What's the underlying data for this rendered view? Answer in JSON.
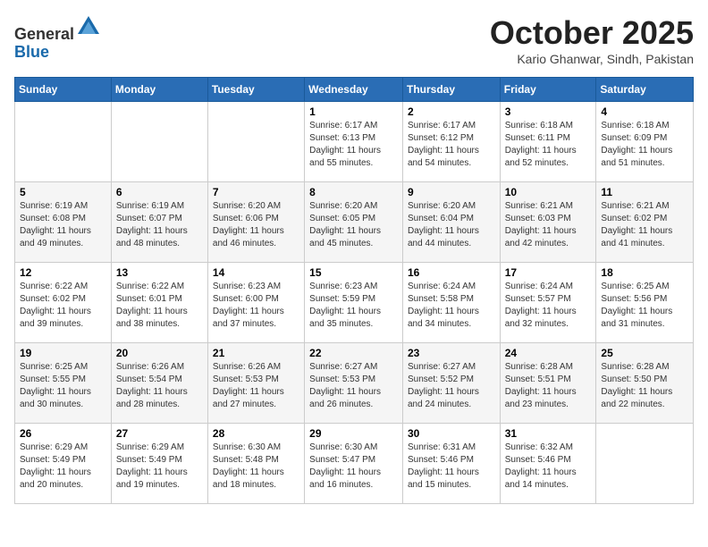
{
  "header": {
    "logo_line1": "General",
    "logo_line2": "Blue",
    "month_title": "October 2025",
    "location": "Kario Ghanwar, Sindh, Pakistan"
  },
  "days_of_week": [
    "Sunday",
    "Monday",
    "Tuesday",
    "Wednesday",
    "Thursday",
    "Friday",
    "Saturday"
  ],
  "weeks": [
    [
      {
        "day": "",
        "info": ""
      },
      {
        "day": "",
        "info": ""
      },
      {
        "day": "",
        "info": ""
      },
      {
        "day": "1",
        "info": "Sunrise: 6:17 AM\nSunset: 6:13 PM\nDaylight: 11 hours\nand 55 minutes."
      },
      {
        "day": "2",
        "info": "Sunrise: 6:17 AM\nSunset: 6:12 PM\nDaylight: 11 hours\nand 54 minutes."
      },
      {
        "day": "3",
        "info": "Sunrise: 6:18 AM\nSunset: 6:11 PM\nDaylight: 11 hours\nand 52 minutes."
      },
      {
        "day": "4",
        "info": "Sunrise: 6:18 AM\nSunset: 6:09 PM\nDaylight: 11 hours\nand 51 minutes."
      }
    ],
    [
      {
        "day": "5",
        "info": "Sunrise: 6:19 AM\nSunset: 6:08 PM\nDaylight: 11 hours\nand 49 minutes."
      },
      {
        "day": "6",
        "info": "Sunrise: 6:19 AM\nSunset: 6:07 PM\nDaylight: 11 hours\nand 48 minutes."
      },
      {
        "day": "7",
        "info": "Sunrise: 6:20 AM\nSunset: 6:06 PM\nDaylight: 11 hours\nand 46 minutes."
      },
      {
        "day": "8",
        "info": "Sunrise: 6:20 AM\nSunset: 6:05 PM\nDaylight: 11 hours\nand 45 minutes."
      },
      {
        "day": "9",
        "info": "Sunrise: 6:20 AM\nSunset: 6:04 PM\nDaylight: 11 hours\nand 44 minutes."
      },
      {
        "day": "10",
        "info": "Sunrise: 6:21 AM\nSunset: 6:03 PM\nDaylight: 11 hours\nand 42 minutes."
      },
      {
        "day": "11",
        "info": "Sunrise: 6:21 AM\nSunset: 6:02 PM\nDaylight: 11 hours\nand 41 minutes."
      }
    ],
    [
      {
        "day": "12",
        "info": "Sunrise: 6:22 AM\nSunset: 6:02 PM\nDaylight: 11 hours\nand 39 minutes."
      },
      {
        "day": "13",
        "info": "Sunrise: 6:22 AM\nSunset: 6:01 PM\nDaylight: 11 hours\nand 38 minutes."
      },
      {
        "day": "14",
        "info": "Sunrise: 6:23 AM\nSunset: 6:00 PM\nDaylight: 11 hours\nand 37 minutes."
      },
      {
        "day": "15",
        "info": "Sunrise: 6:23 AM\nSunset: 5:59 PM\nDaylight: 11 hours\nand 35 minutes."
      },
      {
        "day": "16",
        "info": "Sunrise: 6:24 AM\nSunset: 5:58 PM\nDaylight: 11 hours\nand 34 minutes."
      },
      {
        "day": "17",
        "info": "Sunrise: 6:24 AM\nSunset: 5:57 PM\nDaylight: 11 hours\nand 32 minutes."
      },
      {
        "day": "18",
        "info": "Sunrise: 6:25 AM\nSunset: 5:56 PM\nDaylight: 11 hours\nand 31 minutes."
      }
    ],
    [
      {
        "day": "19",
        "info": "Sunrise: 6:25 AM\nSunset: 5:55 PM\nDaylight: 11 hours\nand 30 minutes."
      },
      {
        "day": "20",
        "info": "Sunrise: 6:26 AM\nSunset: 5:54 PM\nDaylight: 11 hours\nand 28 minutes."
      },
      {
        "day": "21",
        "info": "Sunrise: 6:26 AM\nSunset: 5:53 PM\nDaylight: 11 hours\nand 27 minutes."
      },
      {
        "day": "22",
        "info": "Sunrise: 6:27 AM\nSunset: 5:53 PM\nDaylight: 11 hours\nand 26 minutes."
      },
      {
        "day": "23",
        "info": "Sunrise: 6:27 AM\nSunset: 5:52 PM\nDaylight: 11 hours\nand 24 minutes."
      },
      {
        "day": "24",
        "info": "Sunrise: 6:28 AM\nSunset: 5:51 PM\nDaylight: 11 hours\nand 23 minutes."
      },
      {
        "day": "25",
        "info": "Sunrise: 6:28 AM\nSunset: 5:50 PM\nDaylight: 11 hours\nand 22 minutes."
      }
    ],
    [
      {
        "day": "26",
        "info": "Sunrise: 6:29 AM\nSunset: 5:49 PM\nDaylight: 11 hours\nand 20 minutes."
      },
      {
        "day": "27",
        "info": "Sunrise: 6:29 AM\nSunset: 5:49 PM\nDaylight: 11 hours\nand 19 minutes."
      },
      {
        "day": "28",
        "info": "Sunrise: 6:30 AM\nSunset: 5:48 PM\nDaylight: 11 hours\nand 18 minutes."
      },
      {
        "day": "29",
        "info": "Sunrise: 6:30 AM\nSunset: 5:47 PM\nDaylight: 11 hours\nand 16 minutes."
      },
      {
        "day": "30",
        "info": "Sunrise: 6:31 AM\nSunset: 5:46 PM\nDaylight: 11 hours\nand 15 minutes."
      },
      {
        "day": "31",
        "info": "Sunrise: 6:32 AM\nSunset: 5:46 PM\nDaylight: 11 hours\nand 14 minutes."
      },
      {
        "day": "",
        "info": ""
      }
    ]
  ]
}
